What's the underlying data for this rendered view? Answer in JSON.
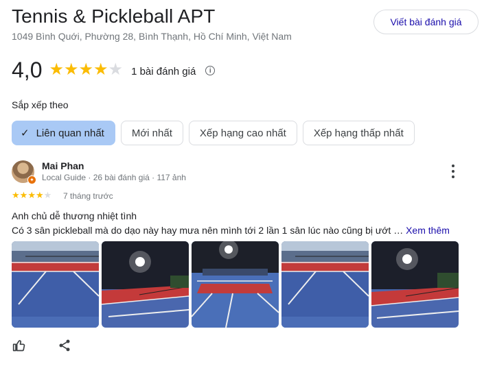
{
  "place": {
    "title": "Tennis & Pickleball APT",
    "address": "1049 Bình Quới, Phường 28, Bình Thạnh, Hồ Chí Minh, Việt Nam",
    "write_review_label": "Viết bài đánh giá"
  },
  "rating": {
    "value": "4,0",
    "stars": 4,
    "max_stars": 5,
    "review_count": "1 bài đánh giá"
  },
  "sort": {
    "label": "Sắp xếp theo",
    "options": [
      "Liên quan nhất",
      "Mới nhất",
      "Xếp hạng cao nhất",
      "Xếp hạng thấp nhất"
    ],
    "selected": "Liên quan nhất"
  },
  "review": {
    "author": "Mai Phan",
    "meta": "Local Guide · 26 bài đánh giá · 117 ảnh",
    "stars": 4,
    "time": "7 tháng trước",
    "line1": "Anh chủ dễ thương nhiệt tình",
    "line2": "Có 3 sân pickleball mà do dạo này hay mưa nên mình tới 2 lần 1 sân lúc nào cũng bị ướt …",
    "see_more": "Xem thêm",
    "photo_count": 5
  },
  "colors": {
    "star": "#fbbc04",
    "star_empty": "#dadce0",
    "selected_chip": "#a9c9f5",
    "link": "#1a0dab"
  },
  "icons": {
    "info": "info-icon",
    "check": "check-icon",
    "more": "more-vert-icon",
    "like": "thumb-up-icon",
    "share": "share-icon"
  }
}
